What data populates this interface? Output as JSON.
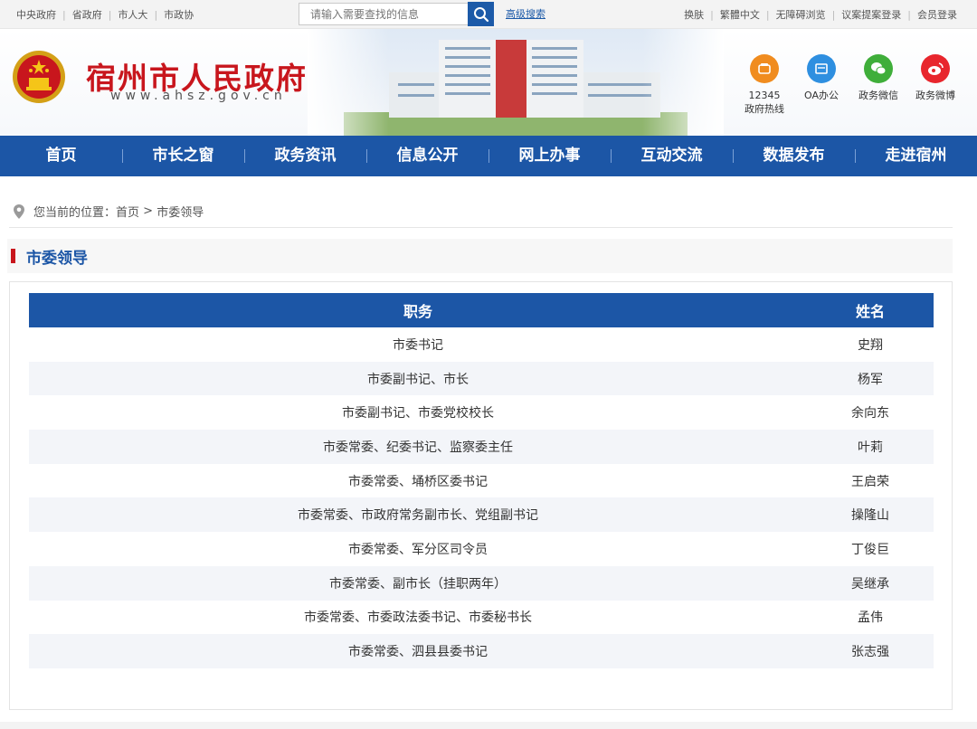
{
  "topbar": {
    "left_links": [
      "中央政府",
      "省政府",
      "市人大",
      "市政协"
    ],
    "search_placeholder": "请输入需要查找的信息",
    "advanced_search": "高级搜索",
    "right_links": [
      "换肤",
      "繁體中文",
      "无障碍浏览",
      "议案提案登录",
      "会员登录"
    ]
  },
  "header": {
    "site_title": "宿州市人民政府",
    "site_url": "www.ahsz.gov.cn",
    "tools": [
      {
        "icon": "phone-icon",
        "label1": "12345",
        "label2": "政府热线",
        "color": "#f08c1f"
      },
      {
        "icon": "oa-icon",
        "label1": "OA办公",
        "label2": "",
        "color": "#2e8fe0"
      },
      {
        "icon": "wechat-icon",
        "label1": "政务微信",
        "label2": "",
        "color": "#3fae3a"
      },
      {
        "icon": "weibo-icon",
        "label1": "政务微博",
        "label2": "",
        "color": "#e8262d"
      }
    ]
  },
  "nav": {
    "items": [
      "首页",
      "市长之窗",
      "政务资讯",
      "信息公开",
      "网上办事",
      "互动交流",
      "数据发布",
      "走进宿州"
    ]
  },
  "breadcrumb": {
    "prefix": "您当前的位置：",
    "home": "首页",
    "sep": " > ",
    "current": "市委领导"
  },
  "section": {
    "title": "市委领导"
  },
  "table": {
    "headers": {
      "position": "职务",
      "name": "姓名"
    },
    "rows": [
      {
        "position": "市委书记",
        "name": "史翔"
      },
      {
        "position": "市委副书记、市长",
        "name": "杨军"
      },
      {
        "position": "市委副书记、市委党校校长",
        "name": "余向东"
      },
      {
        "position": "市委常委、纪委书记、监察委主任",
        "name": "叶莉"
      },
      {
        "position": "市委常委、埇桥区委书记",
        "name": "王启荣"
      },
      {
        "position": "市委常委、市政府常务副市长、党组副书记",
        "name": "操隆山"
      },
      {
        "position": "市委常委、军分区司令员",
        "name": "丁俊巨"
      },
      {
        "position": "市委常委、副市长（挂职两年）",
        "name": "吴继承"
      },
      {
        "position": "市委常委、市委政法委书记、市委秘书长",
        "name": "孟伟"
      },
      {
        "position": "市委常委、泗县县委书记",
        "name": "张志强"
      }
    ]
  },
  "colors": {
    "primary": "#1c56a6",
    "accent_red": "#c8161d"
  }
}
